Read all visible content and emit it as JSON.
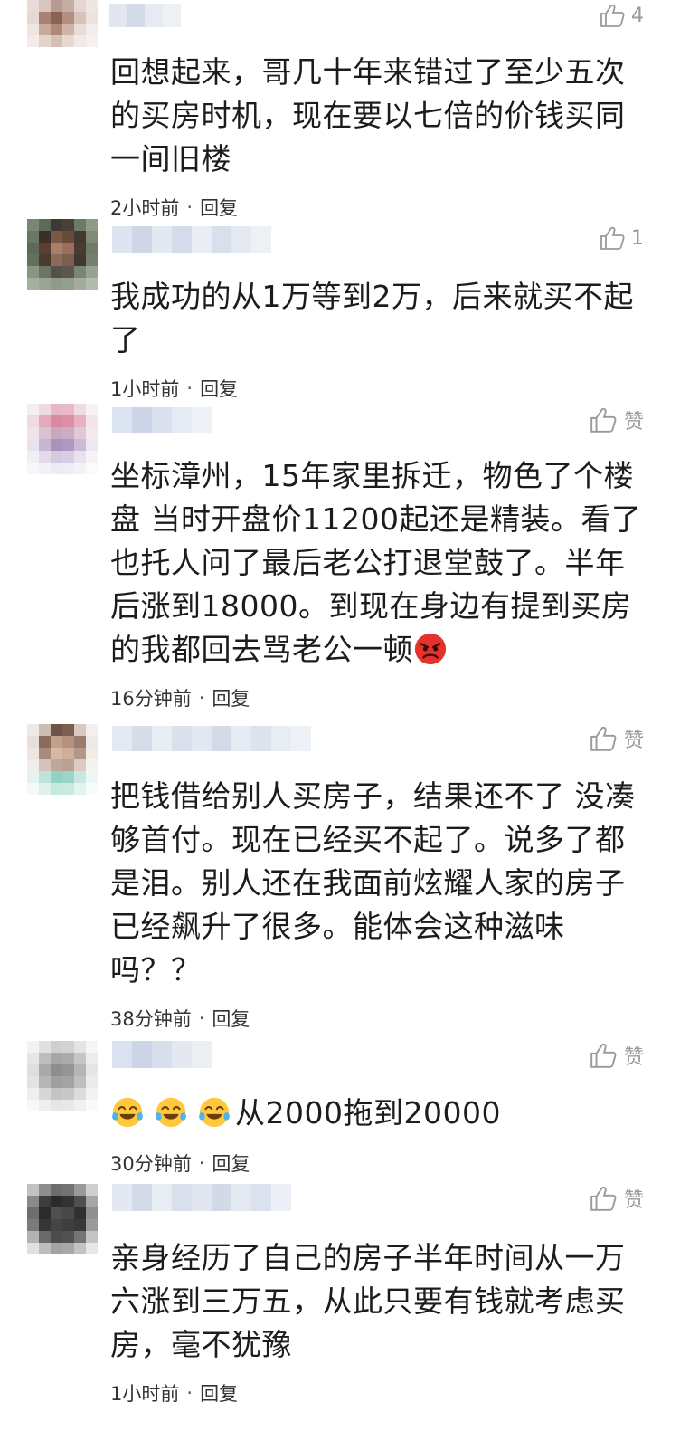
{
  "colors": {
    "text": "#1c1c1c",
    "meta": "#333333",
    "like_icon": "#9a9a9a",
    "background": "#ffffff"
  },
  "comments": [
    {
      "like_count": "4",
      "text": "回想起来，哥几十年来错过了至少五次的买房时机，现在要以七倍的价钱买同一间旧楼",
      "time": "2小时前",
      "reply": "回复"
    },
    {
      "like_count": "1",
      "text": "我成功的从1万等到2万，后来就买不起了",
      "time": "1小时前",
      "reply": "回复"
    },
    {
      "like_count": "赞",
      "text": "坐标漳州，15年家里拆迁，物色了个楼盘 当时开盘价11200起还是精装。看了也托人问了最后老公打退堂鼓了。半年后涨到18000。到现在身边有提到买房的我都回去骂老公一顿",
      "emoji_icon": "angry-face-icon",
      "time": "16分钟前",
      "reply": "回复"
    },
    {
      "like_count": "赞",
      "text": "把钱借给别人买房子，结果还不了 没凑够首付。现在已经买不起了。说多了都是泪。别人还在我面前炫耀人家的房子已经飙升了很多。能体会这种滋味吗？？",
      "time": "38分钟前",
      "reply": "回复"
    },
    {
      "like_count": "赞",
      "emoji_icon": "crying-laughing-icon",
      "text": "从2000拖到20000",
      "time": "30分钟前",
      "reply": "回复"
    },
    {
      "like_count": "赞",
      "text": "亲身经历了自己的房子半年时间从一万六涨到三万五，从此只要有钱就考虑买房，毫不犹豫",
      "time": "1小时前",
      "reply": "回复"
    }
  ]
}
